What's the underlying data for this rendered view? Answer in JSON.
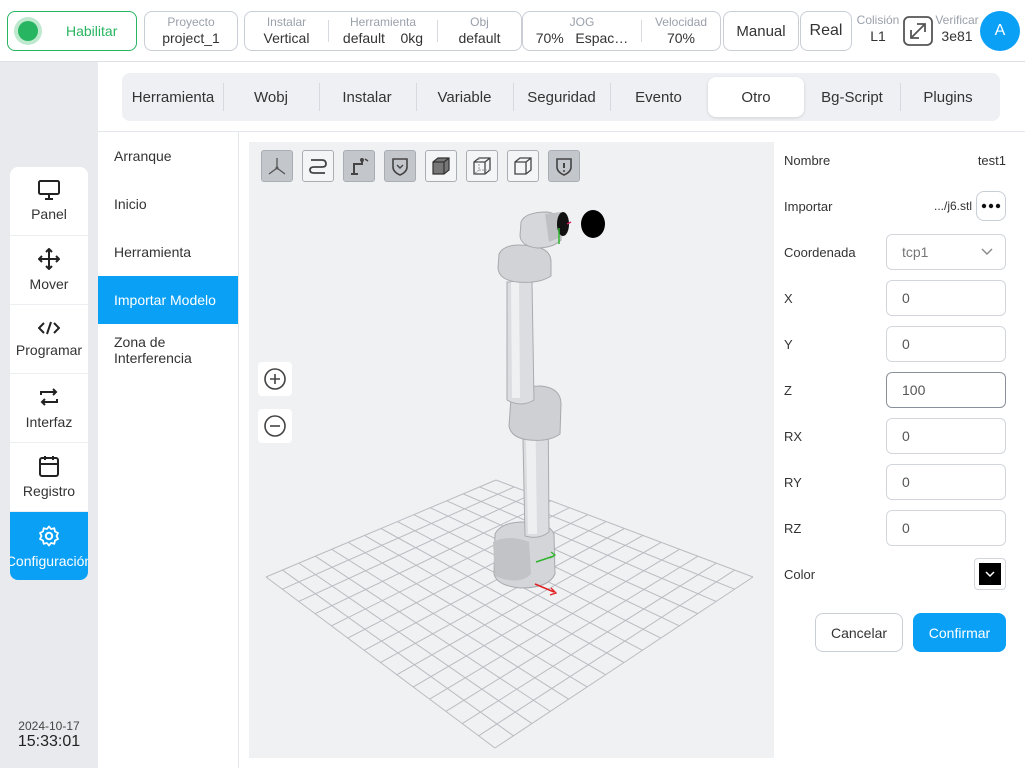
{
  "header": {
    "enable_label": "Habilitar",
    "project": {
      "label": "Proyecto",
      "value": "project_1"
    },
    "install": {
      "label": "Instalar",
      "value": "Vertical"
    },
    "tool": {
      "label": "Herramienta",
      "value": "default",
      "weight": "0kg"
    },
    "obj": {
      "label": "Obj",
      "value": "default"
    },
    "jog": {
      "label": "JOG",
      "value": "70%",
      "mode": "Espac…"
    },
    "speed": {
      "label": "Velocidad",
      "value": "70%"
    },
    "manual_label": "Manual",
    "real_label": "Real",
    "collision": {
      "label": "Colisión",
      "value": "L1"
    },
    "verify": {
      "label": "Verificar",
      "value": "3e81"
    },
    "avatar_letter": "A",
    "accent_color": "#0aa0f5",
    "enable_color": "#27b561"
  },
  "nav": {
    "items": [
      {
        "label": "Panel",
        "icon": "monitor-icon"
      },
      {
        "label": "Mover",
        "icon": "move-arrows-icon"
      },
      {
        "label": "Programar",
        "icon": "code-icon"
      },
      {
        "label": "Interfaz",
        "icon": "swap-arrows-icon"
      },
      {
        "label": "Registro",
        "icon": "calendar-icon"
      },
      {
        "label": "Configuración",
        "icon": "gear-icon",
        "active": true
      }
    ],
    "date": "2024-10-17",
    "time": "15:33:01"
  },
  "tabs": [
    {
      "label": "Herramienta"
    },
    {
      "label": "Wobj"
    },
    {
      "label": "Instalar"
    },
    {
      "label": "Variable"
    },
    {
      "label": "Seguridad"
    },
    {
      "label": "Evento"
    },
    {
      "label": "Otro",
      "active": true
    },
    {
      "label": "Bg-Script"
    },
    {
      "label": "Plugins"
    }
  ],
  "submenu": [
    {
      "label": "Arranque"
    },
    {
      "label": "Inicio"
    },
    {
      "label": "Herramienta"
    },
    {
      "label": "Importar Modelo",
      "active": true
    },
    {
      "label": "Zona de Interferencia"
    }
  ],
  "viewport": {
    "toolbar_icons": [
      "axes-view-icon",
      "path-icon",
      "robot-arm-icon",
      "shield-icon",
      "cube-solid-icon",
      "cube-wire-icon",
      "cube-outline-icon",
      "shield-alert-icon"
    ],
    "zoom_in_icon": "zoom-in-icon",
    "zoom_out_icon": "zoom-out-icon"
  },
  "form": {
    "name": {
      "label": "Nombre",
      "value": "test1"
    },
    "import": {
      "label": "Importar",
      "value": ".../j6.stl"
    },
    "coordinate": {
      "label": "Coordenada",
      "value": "tcp1"
    },
    "x": {
      "label": "X",
      "value": "0"
    },
    "y": {
      "label": "Y",
      "value": "0"
    },
    "z": {
      "label": "Z",
      "value": "100"
    },
    "rx": {
      "label": "RX",
      "value": "0"
    },
    "ry": {
      "label": "RY",
      "value": "0"
    },
    "rz": {
      "label": "RZ",
      "value": "0"
    },
    "color": {
      "label": "Color",
      "value": "#000000"
    },
    "cancel_label": "Cancelar",
    "confirm_label": "Confirmar"
  }
}
